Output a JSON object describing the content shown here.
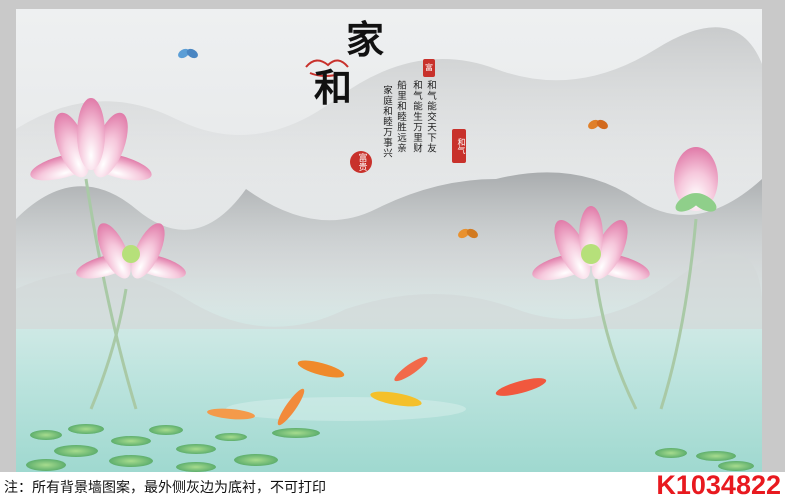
{
  "artwork": {
    "title_main": "家",
    "title_sub": "和",
    "seal_small": "富",
    "seal_round": "富贵",
    "seal_vertical": "和气",
    "poem_columns": [
      "和气能交天下友",
      "和气能生万里财",
      "船里和睦胜远亲",
      "家庭和睦万事兴"
    ]
  },
  "footer": {
    "note": "注：所有背景墙图案，最外侧灰边为底衬，不可打印",
    "code": "K1034822"
  },
  "colors": {
    "code_red": "#e8191f",
    "seal_red": "#c8312b",
    "water_teal": "#a9ddd5",
    "lotus_pink": "#f2a9c8"
  }
}
